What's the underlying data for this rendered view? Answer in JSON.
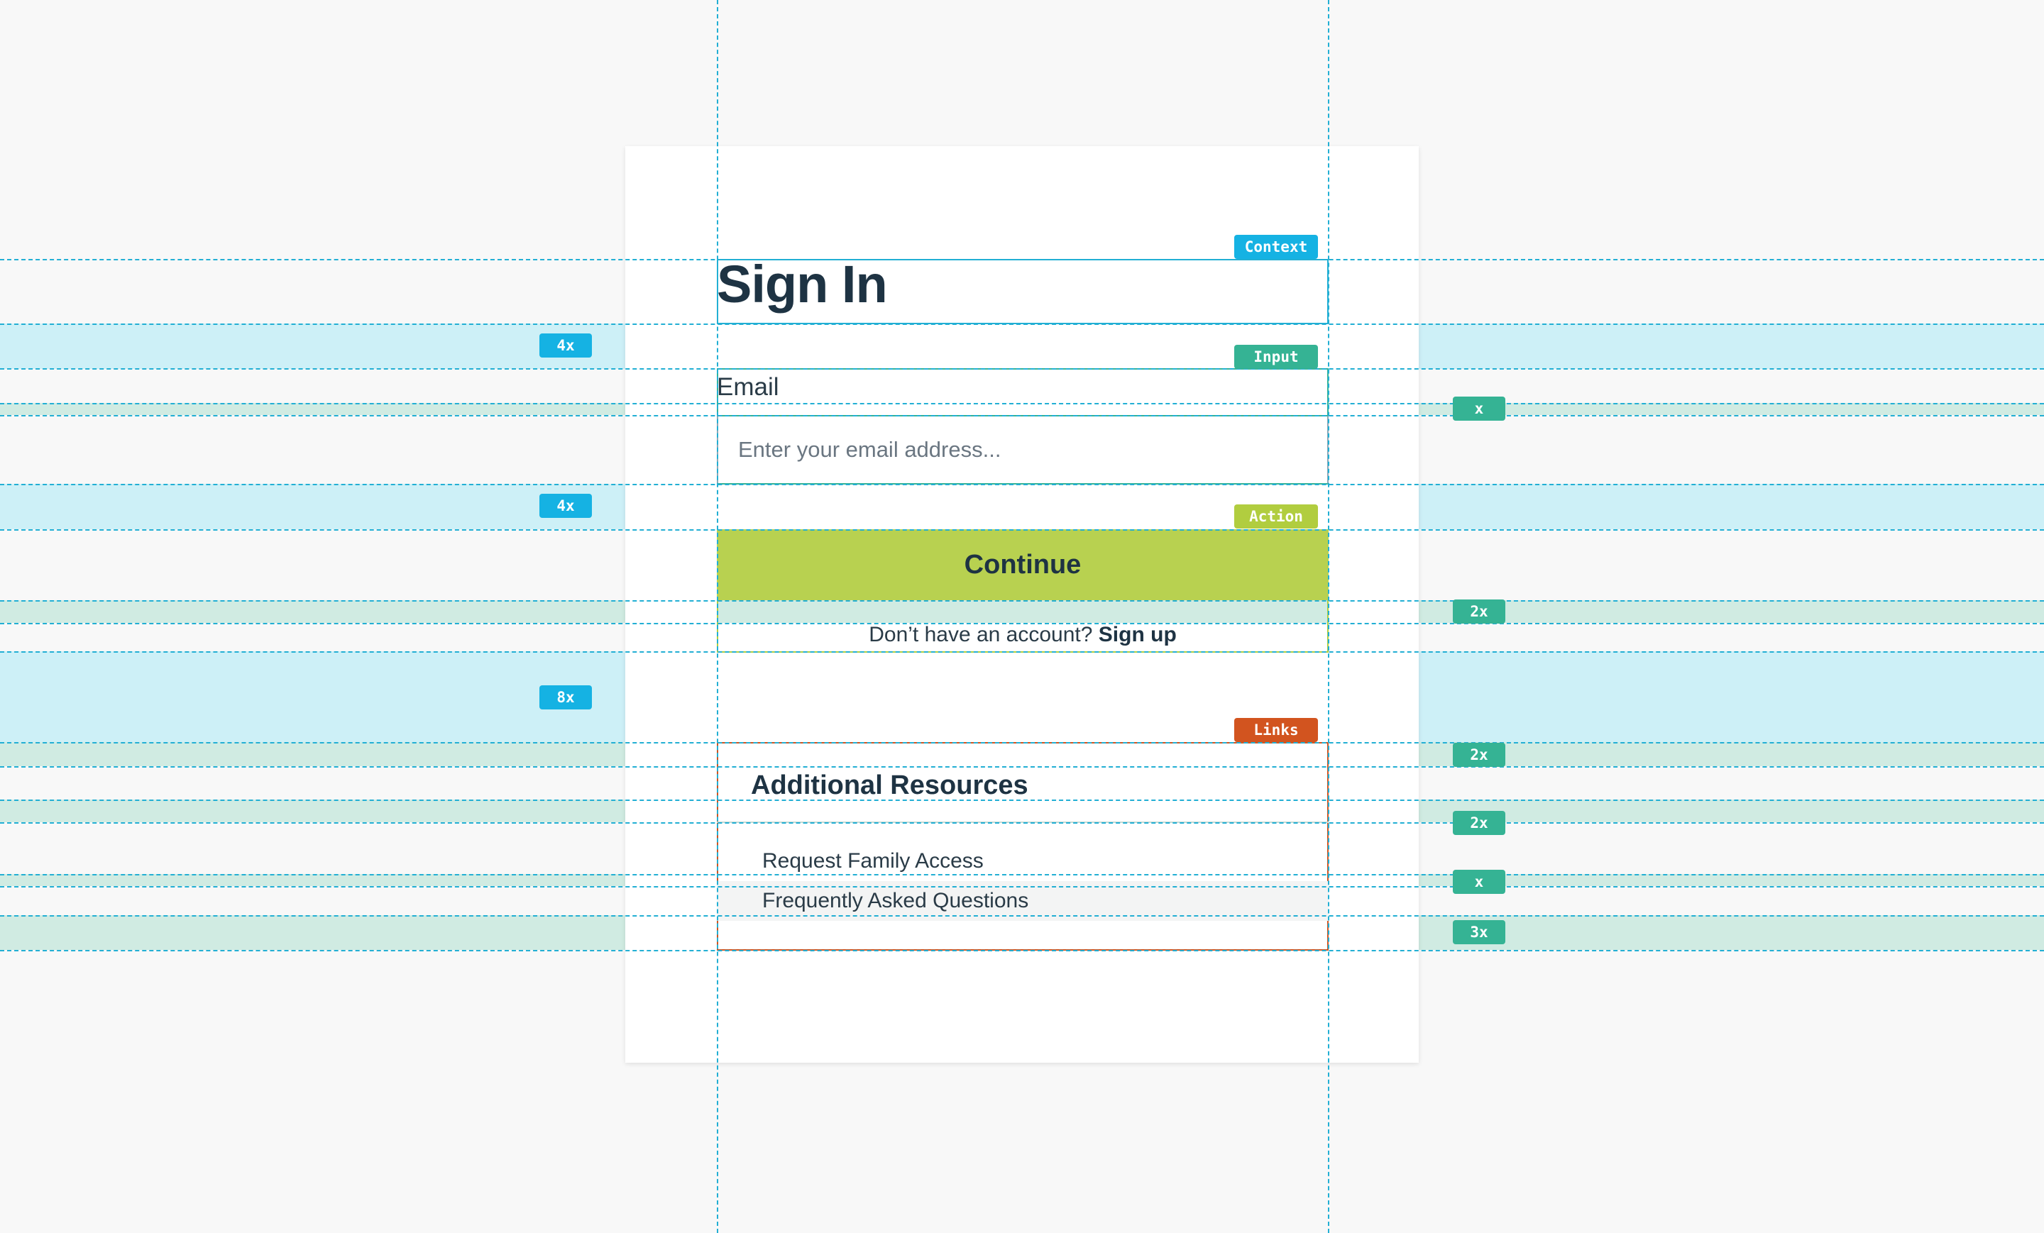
{
  "page": {
    "title": "Sign In",
    "email_label": "Email",
    "email_placeholder": "Enter your email address...",
    "email_value": "",
    "continue_label": "Continue",
    "signup_prompt": "Don’t have an account?",
    "signup_link": "Sign up",
    "resources": {
      "heading": "Additional Resources",
      "links": [
        "Request Family Access",
        "Frequently Asked Questions"
      ]
    }
  },
  "annotations": {
    "region_tags": {
      "context": "Context",
      "input": "Input",
      "action": "Action",
      "links": "Links"
    },
    "spacing_tags": {
      "title_to_input": "4x",
      "label_to_field": "x",
      "field_to_action": "4x",
      "button_to_signup": "2x",
      "action_to_links": "8x",
      "links_top_padding": "2x",
      "heading_gap": "2x",
      "link_gap": "x",
      "links_bottom_padding": "3x"
    }
  },
  "colors": {
    "page_background": "#f8f8f8",
    "card_background": "#ffffff",
    "guide_line": "#22afd4",
    "band_blue": "#cdf0f7",
    "band_green": "#d0ebe2",
    "context_tag": "#15b2e3",
    "input_tag": "#35b394",
    "action_tag": "#b1cd3f",
    "links_tag": "#d2541f",
    "button_fill": "#b8d150",
    "text_dark": "#1e3343"
  }
}
